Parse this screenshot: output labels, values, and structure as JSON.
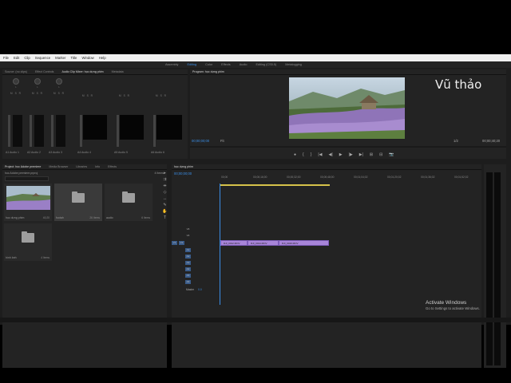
{
  "menu": [
    "File",
    "Edit",
    "Clip",
    "Sequence",
    "Marker",
    "Title",
    "Window",
    "Help"
  ],
  "workspaces": [
    "Assembly",
    "Editing",
    "Color",
    "Effects",
    "Audio",
    "Editing (CS5.5)",
    "Metalogging"
  ],
  "mixer": {
    "tabs": [
      "Source: (no clips)",
      "Effect Controls",
      "Audio Clip Mixer: học dựng phim",
      "Metadata"
    ],
    "channel_labels": [
      "L",
      "L",
      "L",
      "R",
      "R",
      "R",
      "",
      ""
    ],
    "msr": "M S R",
    "channels": [
      "A1  Audio 1",
      "A2  Audio 2",
      "A3  Audio 3",
      "A4  Audio 4",
      "A5  Audio 5",
      "A6  Audio 6"
    ]
  },
  "program": {
    "tab": "Program: học dựng phim",
    "watermark": "Vũ thảo",
    "timecode_left": "00;00;00;00",
    "fit": "Fit",
    "quality": "1/2",
    "timecode_right": "00;00;40;20",
    "controls": [
      "●",
      "{",
      "}",
      "|◀",
      "◀|",
      "▶",
      "|▶",
      "▶|",
      "⊞",
      "⊟",
      "📷"
    ]
  },
  "project": {
    "tabs": [
      "Project: hoc Adobe premiere",
      "Media Browser",
      "Libraries",
      "Info",
      "Effects"
    ],
    "path": "hoc Adobe premiere.prproj",
    "count": "4 Items",
    "bins": [
      {
        "name": "học dựng phim",
        "count": "40;20"
      },
      {
        "name": "footah",
        "count": "26 Items"
      },
      {
        "name": "audio",
        "count": "6 Items"
      },
      {
        "name": "hình ảnh",
        "count": "4 Items"
      }
    ]
  },
  "timeline": {
    "tab": "học dựng phim",
    "timecode": "00;00;00;00",
    "ruler": [
      "00;00",
      "00;00;16;00",
      "00;00;32;00",
      "00;00;48;00",
      "00;01;04;02",
      "00;01;20;02",
      "00;01;36;02",
      "00;01;52;02"
    ],
    "tracks": [
      {
        "id": "V3",
        "type": "video"
      },
      {
        "id": "V2",
        "type": "video"
      },
      {
        "id": "V1",
        "type": "video"
      },
      {
        "id": "A1",
        "type": "audio"
      },
      {
        "id": "A2",
        "type": "audio"
      },
      {
        "id": "A3",
        "type": "audio"
      },
      {
        "id": "A4",
        "type": "audio"
      },
      {
        "id": "A5",
        "type": "audio"
      },
      {
        "id": "A6",
        "type": "audio"
      },
      {
        "id": "Master",
        "type": "master",
        "value": "0.0"
      }
    ],
    "clips": [
      "DJI_0012.MOV",
      "DJI_0014.MOV",
      "DJI_0016.MOV"
    ]
  },
  "activate": {
    "title": "Activate Windows",
    "subtitle": "Go to Settings to activate Windows."
  }
}
